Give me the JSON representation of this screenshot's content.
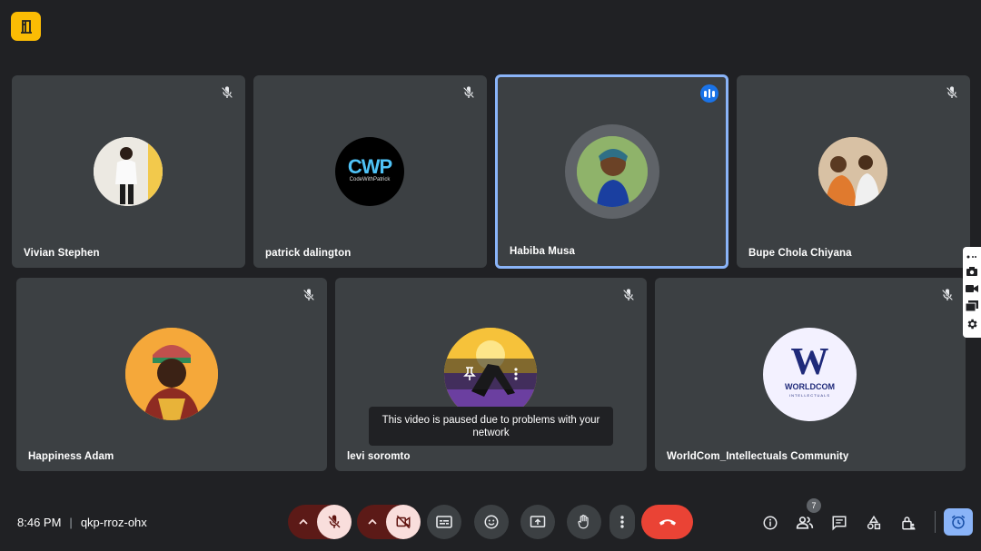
{
  "participants": [
    {
      "name": "Vivian Stephen"
    },
    {
      "name": "patrick dalington"
    },
    {
      "name": "Habiba Musa"
    },
    {
      "name": "Bupe Chola Chiyana"
    },
    {
      "name": "Happiness Adam"
    },
    {
      "name": "levi soromto"
    },
    {
      "name": "WorldCom_Intellectuals Community"
    }
  ],
  "logos": {
    "cwp_text": "CWP",
    "cwp_sub": "CodeWithPatrick",
    "worldcom_letter": "W",
    "worldcom_text": "WORLDCOM",
    "worldcom_sub": "INTELLECTUALS"
  },
  "toast": {
    "message": "This video is paused due to problems with your network"
  },
  "meeting": {
    "time": "8:46 PM",
    "separator": "|",
    "code": "qkp-rroz-ohx"
  },
  "people_count": "7",
  "colors": {
    "active_border": "#8ab4f8",
    "end_call": "#ea4335",
    "muted_bg": "#f9dedc",
    "muted_dark": "#601410",
    "badge": "#fbbc04"
  }
}
